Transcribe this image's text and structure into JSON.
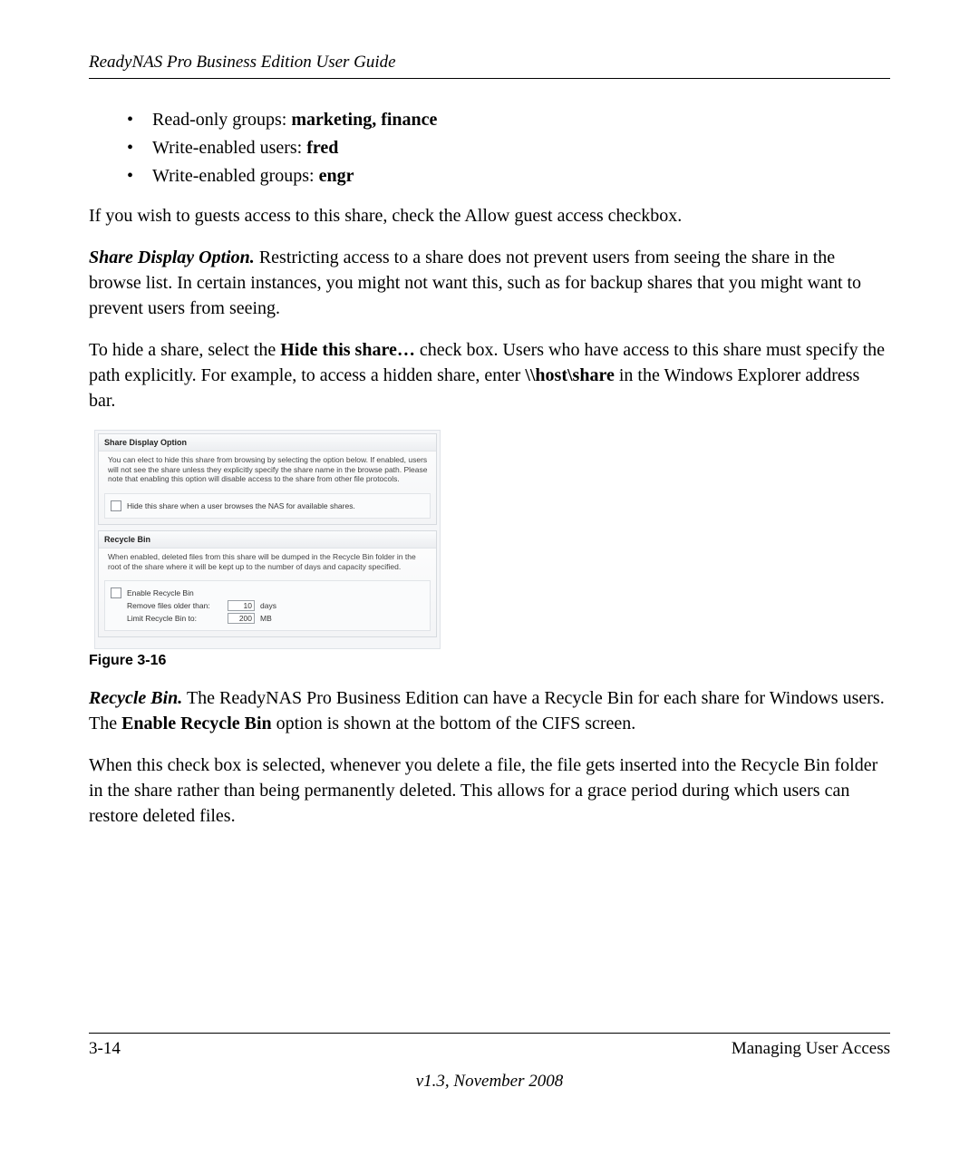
{
  "header": {
    "title": "ReadyNAS Pro Business Edition User Guide"
  },
  "bullets": [
    {
      "prefix": "Read-only groups: ",
      "bold": "marketing, finance"
    },
    {
      "prefix": "Write-enabled users: ",
      "bold": "fred"
    },
    {
      "prefix": "Write-enabled groups: ",
      "bold": "engr"
    }
  ],
  "para_guest": "If you wish to guests access to this share, check the Allow guest access checkbox.",
  "share_display": {
    "runin": "Share Display Option.",
    "rest": " Restricting access to a share does not prevent users from seeing the share in the browse list. In certain instances, you might not want this, such as for backup shares that you might want to prevent users from seeing."
  },
  "hide_para": {
    "a": "To hide a share, select the ",
    "b": "Hide this share…",
    "c": " check box. Users who have access to this share must specify the path explicitly. For example, to access a hidden share, enter ",
    "d": "\\\\host\\share",
    "e": " in the Windows Explorer address bar."
  },
  "shot": {
    "p1_title": "Share Display Option",
    "p1_text": "You can elect to hide this share from browsing by selecting the option below. If enabled, users will not see the share unless they explicitly specify the share name in the browse path. Please note that enabling this option will disable access to the share from other file protocols.",
    "p1_check": "Hide this share when a user browses the NAS for available shares.",
    "p2_title": "Recycle Bin",
    "p2_text": "When enabled, deleted files from this share will be dumped in the Recycle Bin folder in the root of the share where it will be kept up to the number of days and capacity specified.",
    "p2_check": "Enable Recycle Bin",
    "remove_label": "Remove files older than:",
    "remove_value": "10",
    "remove_unit": "days",
    "limit_label": "Limit Recycle Bin to:",
    "limit_value": "200",
    "limit_unit": "MB"
  },
  "fig_caption": "Figure 3-16",
  "recycle_para": {
    "runin": "Recycle Bin.",
    "a": " The ReadyNAS Pro Business Edition can have a Recycle Bin for each share for Windows users. The ",
    "b": "Enable Recycle Bin",
    "c": " option is shown at the bottom of the CIFS screen."
  },
  "para_grace": "When this check box is selected, whenever you delete a file, the file gets inserted into the Recycle Bin folder in the share rather than being permanently deleted. This allows for a grace period during which users can restore deleted files.",
  "footer": {
    "page": "3-14",
    "section": "Managing User Access",
    "version": "v1.3, November 2008"
  }
}
